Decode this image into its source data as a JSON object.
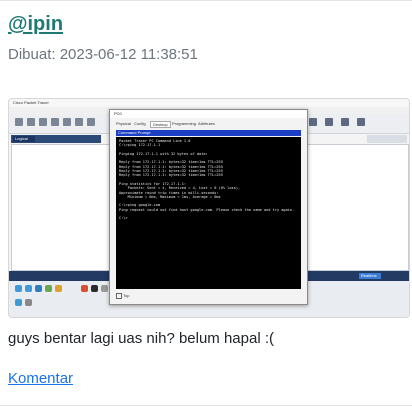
{
  "post": {
    "username": "@ipin",
    "created": "Dibuat: 2023-06-12 11:38:51",
    "caption": "guys bentar lagi uas nih? belum hapal :(",
    "comment_link": "Komentar"
  },
  "screenshot": {
    "app_title": "Cisco Packet Tracer",
    "workspace_tab": "Logical",
    "pc_window": {
      "title": "PC0",
      "tabs": [
        "Physical",
        "Config",
        "Desktop",
        "Programming",
        "Attributes"
      ],
      "active_tab": "Desktop",
      "command_title": "Command Prompt",
      "footer_checkbox": "Top",
      "terminal_lines": [
        "Packet Tracer PC Command Line 1.0",
        "C:\\>ping 172.17.1.1",
        "",
        "Pinging 172.17.1.1 with 32 bytes of data:",
        "",
        "Reply from 172.17.1.1: bytes=32 time=1ms TTL=255",
        "Reply from 172.17.1.1: bytes=32 time<1ms TTL=255",
        "Reply from 172.17.1.1: bytes=32 time<1ms TTL=255",
        "Reply from 172.17.1.1: bytes=32 time<1ms TTL=255",
        "",
        "Ping statistics for 172.17.1.1:",
        "    Packets: Sent = 4, Received = 4, Lost = 0 (0% loss),",
        "Approximate round trip times in milli-seconds:",
        "    Minimum = 0ms, Maximum = 1ms, Average = 0ms",
        "",
        "C:\\>ping google.com",
        "Ping request could not find host google.com. Please check the name and try again.",
        "",
        "C:\\>"
      ]
    },
    "realtime_label": "Realtime",
    "colors": {
      "status_bar": "#233a63",
      "cmd_bar": "#1a3ec4",
      "terminal_bg": "#000000",
      "link": "#1a73e8",
      "username": "#1e7a73"
    }
  }
}
